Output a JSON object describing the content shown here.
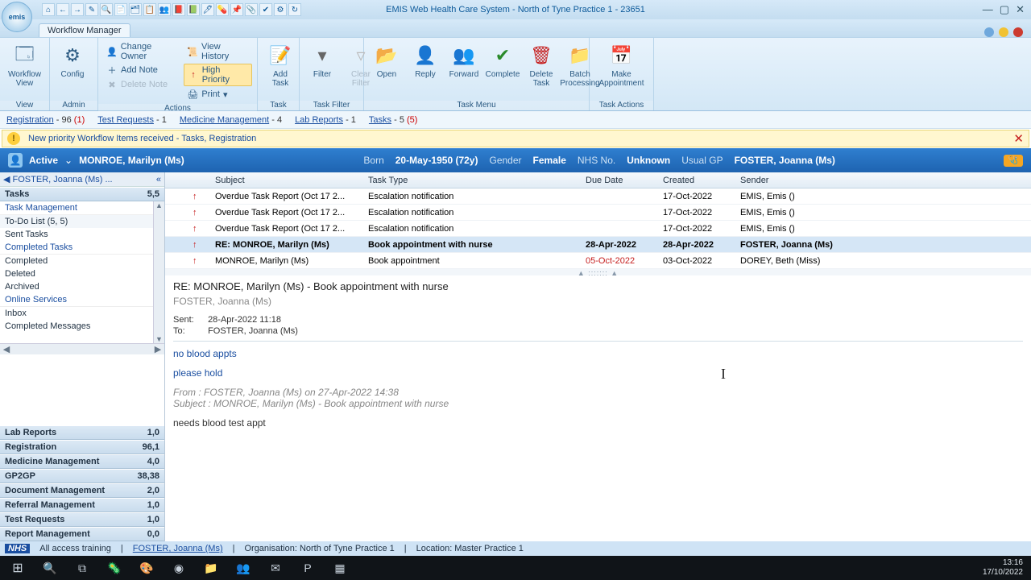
{
  "title": "EMIS Web Health Care System - North of Tyne Practice 1 - 23651",
  "module_tab": "Workflow Manager",
  "logo_text": "emis",
  "ribbon": {
    "groups": {
      "view": {
        "label": "View",
        "btn": "Workflow\nView"
      },
      "admin": {
        "label": "Admin",
        "btn": "Config"
      },
      "actions": {
        "label": "Actions",
        "change_owner": "Change Owner",
        "view_history": "View History",
        "add_note": "Add Note",
        "high_priority": "High Priority",
        "delete_note": "Delete Note",
        "print": "Print"
      },
      "task": {
        "label": "Task",
        "btn": "Add\nTask"
      },
      "task_filter": {
        "label": "Task Filter",
        "filter": "Filter",
        "clear": "Clear\nFilter"
      },
      "task_menu": {
        "label": "Task Menu",
        "open": "Open",
        "reply": "Reply",
        "forward": "Forward",
        "complete": "Complete",
        "delete": "Delete\nTask",
        "batch": "Batch\nProcessing"
      },
      "task_actions": {
        "label": "Task Actions",
        "make": "Make\nAppointment"
      }
    }
  },
  "filters": [
    {
      "name": "Registration",
      "count": "- 96",
      "extra": "(1)"
    },
    {
      "name": "Test Requests",
      "count": "- 1",
      "extra": ""
    },
    {
      "name": "Medicine Management",
      "count": "- 4",
      "extra": ""
    },
    {
      "name": "Lab Reports",
      "count": "- 1",
      "extra": ""
    },
    {
      "name": "Tasks",
      "count": "- 5",
      "extra": "(5)"
    }
  ],
  "alert": "New priority Workflow Items received - Tasks, Registration",
  "patient": {
    "status": "Active",
    "name": "MONROE, Marilyn (Ms)",
    "born_label": "Born",
    "born": "20-May-1950 (72y)",
    "gender_label": "Gender",
    "gender": "Female",
    "nhs_label": "NHS No.",
    "nhs": "Unknown",
    "gp_label": "Usual GP",
    "gp": "FOSTER, Joanna (Ms)"
  },
  "sidebar": {
    "crumb": "FOSTER, Joanna (Ms) ...",
    "tasks_header": {
      "title": "Tasks",
      "count": "5,5"
    },
    "groups": [
      {
        "title": "Task Management"
      },
      {
        "title": "Online Services"
      }
    ],
    "items1": [
      "To-Do List (5, 5)",
      "Sent Tasks"
    ],
    "completed_hdr": "Completed Tasks",
    "items2": [
      "Completed",
      "Deleted",
      "Archived"
    ],
    "items3": [
      "Inbox",
      "Completed Messages"
    ],
    "stacks": [
      {
        "t": "Lab Reports",
        "c": "1,0"
      },
      {
        "t": "Registration",
        "c": "96,1"
      },
      {
        "t": "Medicine Management",
        "c": "4,0"
      },
      {
        "t": "GP2GP",
        "c": "38,38"
      },
      {
        "t": "Document Management",
        "c": "2,0"
      },
      {
        "t": "Referral Management",
        "c": "1,0"
      },
      {
        "t": "Test Requests",
        "c": "1,0"
      },
      {
        "t": "Report Management",
        "c": "0,0"
      }
    ]
  },
  "table": {
    "headers": {
      "subject": "Subject",
      "type": "Task Type",
      "due": "Due Date",
      "created": "Created",
      "sender": "Sender"
    },
    "rows": [
      {
        "sub": "Overdue Task Report (Oct 17 2...",
        "type": "Escalation notification",
        "due": "",
        "cre": "17-Oct-2022",
        "snd": "EMIS, Emis ()",
        "sel": false,
        "bold": false
      },
      {
        "sub": "Overdue Task Report (Oct 17 2...",
        "type": "Escalation notification",
        "due": "",
        "cre": "17-Oct-2022",
        "snd": "EMIS, Emis ()",
        "sel": false,
        "bold": false
      },
      {
        "sub": "Overdue Task Report (Oct 17 2...",
        "type": "Escalation notification",
        "due": "",
        "cre": "17-Oct-2022",
        "snd": "EMIS, Emis ()",
        "sel": false,
        "bold": false
      },
      {
        "sub": "RE: MONROE, Marilyn (Ms)",
        "type": "Book appointment with nurse",
        "due": "28-Apr-2022",
        "cre": "28-Apr-2022",
        "snd": "FOSTER, Joanna (Ms)",
        "sel": true,
        "bold": true
      },
      {
        "sub": "MONROE, Marilyn (Ms)",
        "type": "Book appointment",
        "due": "05-Oct-2022",
        "cre": "03-Oct-2022",
        "snd": "DOREY, Beth (Miss)",
        "sel": false,
        "bold": false,
        "due_red": true
      }
    ]
  },
  "preview": {
    "title": "RE: MONROE, Marilyn (Ms) - Book appointment with nurse",
    "from": "FOSTER, Joanna (Ms)",
    "sent_label": "Sent:",
    "sent": "28-Apr-2022 11:18",
    "to_label": "To:",
    "to": "FOSTER, Joanna (Ms)",
    "line1": "no blood appts",
    "line2": "please hold",
    "quoted_from": "From : FOSTER, Joanna (Ms) on 27-Apr-2022 14:38",
    "quoted_subj": "Subject : MONROE, Marilyn (Ms) - Book appointment with nurse",
    "body": "needs blood test appt"
  },
  "status": {
    "training": "All access training",
    "user": "FOSTER, Joanna (Ms)",
    "org": "Organisation: North of Tyne Practice 1",
    "loc": "Location: Master Practice 1"
  },
  "clock": {
    "time": "13:16",
    "date": "17/10/2022"
  }
}
